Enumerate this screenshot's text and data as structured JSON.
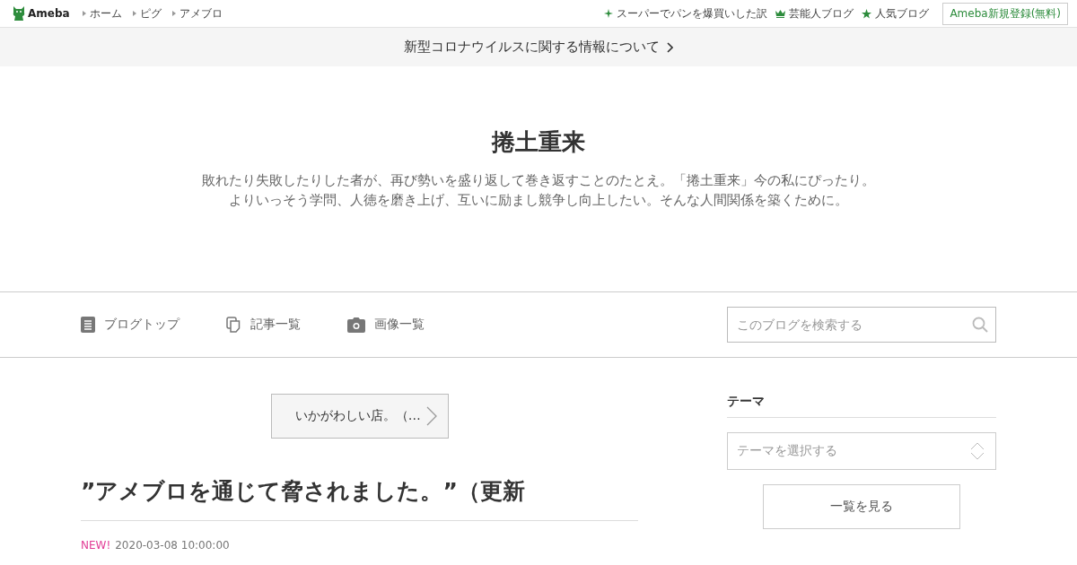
{
  "header": {
    "logo": "Ameba",
    "breadcrumbs": [
      "ホーム",
      "ピグ",
      "アメブロ"
    ],
    "links": [
      {
        "kind": "sparkle",
        "label": "スーパーでパンを爆買いした訳"
      },
      {
        "kind": "crown",
        "label": "芸能人ブログ"
      },
      {
        "kind": "star",
        "label": "人気ブログ"
      }
    ],
    "signup": "Ameba新規登録(無料)"
  },
  "notice": "新型コロナウイルスに関する情報について",
  "blog": {
    "title": "捲土重来",
    "description": [
      "敗れたり失敗したりした者が、再び勢いを盛り返して巻き返すことのたとえ。「捲土重来」今の私にぴったり。",
      "よりいっそう学問、人徳を磨き上げ、互いに励まし競争し向上したい。そんな人間関係を築くために。"
    ]
  },
  "nav": [
    {
      "kind": "document",
      "label": "ブログトップ"
    },
    {
      "kind": "pages",
      "label": "記事一覧"
    },
    {
      "kind": "camera",
      "label": "画像一覧"
    }
  ],
  "search": {
    "placeholder": "このブログを検索する"
  },
  "prev_article": "いかがわしい店。（…",
  "article": {
    "title": "”アメブロを通じて脅されました。”（更新",
    "badge": "NEW!",
    "date": "2020-03-08 10:00:00"
  },
  "sidebar": {
    "heading": "テーマ",
    "select_placeholder": "テーマを選択する",
    "button": "一覧を見る"
  }
}
